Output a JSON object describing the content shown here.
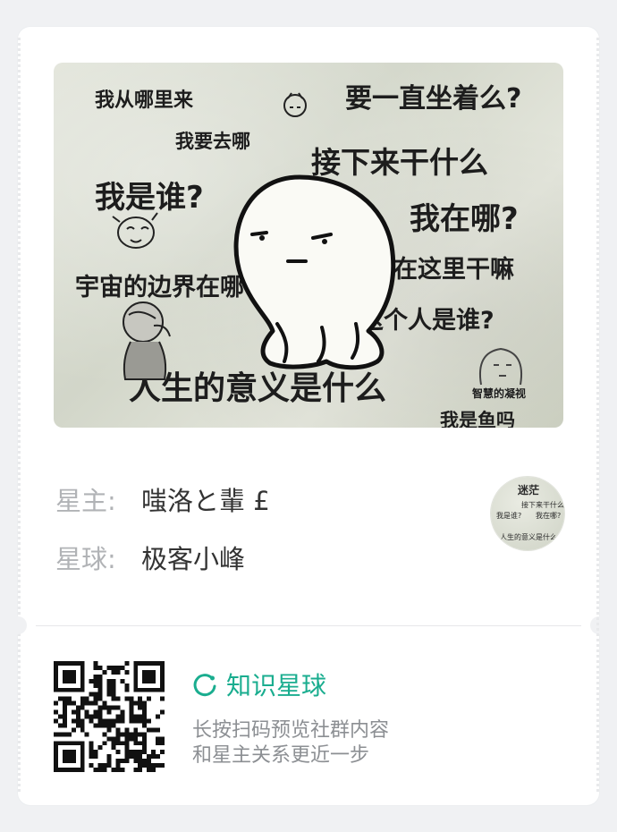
{
  "cover": {
    "texts": [
      "我从哪里来",
      "要一直坐着么?",
      "我要去哪",
      "接下来干什么",
      "我是谁?",
      "我在哪?",
      "宇宙的边界在哪",
      "我坐在这里干嘛",
      "这个人是谁?",
      "智慧的凝视",
      "人生的意义是什么",
      "我是鱼吗"
    ]
  },
  "meta": {
    "owner_label": "星主:",
    "owner_value": "嗤洛と輩 £",
    "planet_label": "星球:",
    "planet_value": "极客小峰"
  },
  "thumb": {
    "texts": [
      "迷茫",
      "接下来干什么",
      "我在哪?",
      "我是谁?",
      "人生的意义是什么"
    ]
  },
  "footer": {
    "brand": "知识星球",
    "brand_icon": "zsxq-logo-icon",
    "brand_color": "#1aad8f",
    "tip_line1": "长按扫码预览社群内容",
    "tip_line2": "和星主关系更近一步"
  }
}
